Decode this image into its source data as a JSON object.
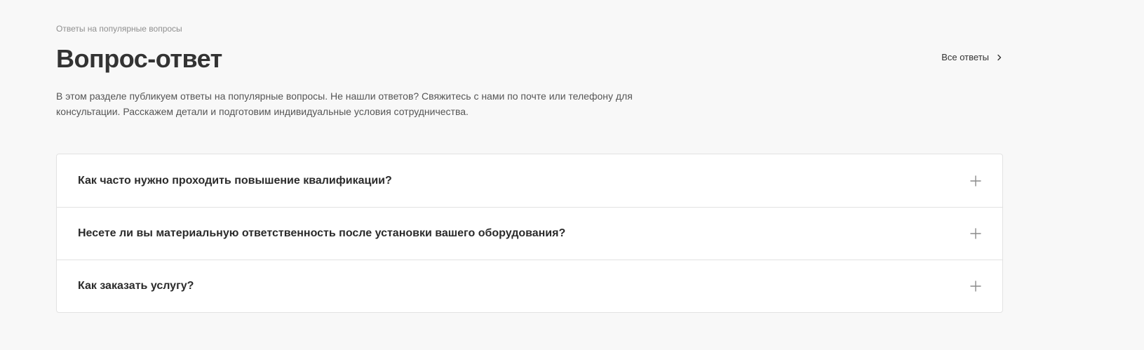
{
  "section": {
    "eyebrow": "Ответы на популярные вопросы",
    "title": "Вопрос-ответ",
    "all_link_label": "Все ответы",
    "all_link_icon": "chevron-right-icon",
    "lead": "В этом разделе публикуем ответы на популярные вопросы. Не нашли ответов? Свяжитесь с нами по почте или телефону для консультации. Расскажем детали и подготовим индивидуальные условия сотрудничества."
  },
  "faq": {
    "items": [
      {
        "question": "Как часто нужно проходить повышение квалификации?",
        "icon": "plus-icon"
      },
      {
        "question": "Несете ли вы материальную ответственность после установки вашего оборудования?",
        "icon": "plus-icon"
      },
      {
        "question": "Как заказать услугу?",
        "icon": "plus-icon"
      }
    ]
  },
  "colors": {
    "background": "#f8f8f8",
    "card": "#ffffff",
    "border": "#e2e2e2",
    "text": "#2b2b2b",
    "muted": "#8f8f8f"
  }
}
